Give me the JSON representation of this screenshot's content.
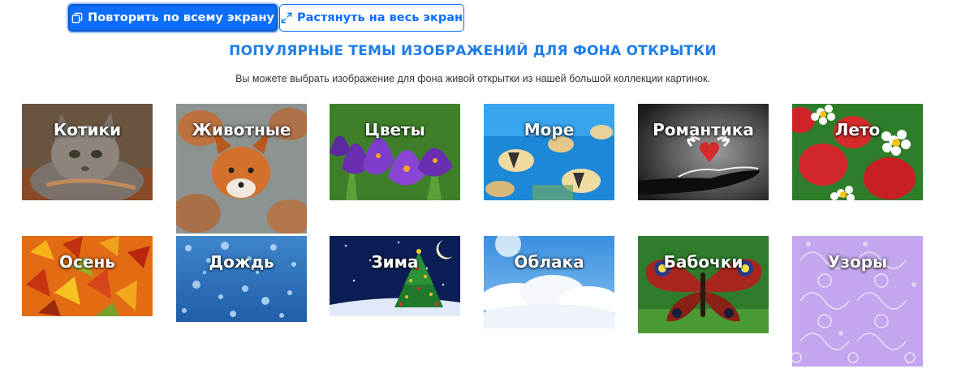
{
  "toolbar": {
    "repeat_label": "Повторить по всему экрану",
    "stretch_label": "Растянуть на весь экран"
  },
  "section": {
    "title": "ПОПУЛЯРНЫЕ ТЕМЫ ИЗОБРАЖЕНИЙ ДЛЯ ФОНА ОТКРЫТКИ",
    "subtitle": "Вы можете выбрать изображение для фона живой открытки из нашей большой коллекции картинок."
  },
  "categories": [
    {
      "label": "Котики",
      "theme": "cat"
    },
    {
      "label": "Животные",
      "theme": "fox"
    },
    {
      "label": "Цветы",
      "theme": "crocus"
    },
    {
      "label": "Море",
      "theme": "sea"
    },
    {
      "label": "Романтика",
      "theme": "romance"
    },
    {
      "label": "Лето",
      "theme": "strawberry"
    },
    {
      "label": "Осень",
      "theme": "leaves"
    },
    {
      "label": "Дождь",
      "theme": "rain"
    },
    {
      "label": "Зима",
      "theme": "winter"
    },
    {
      "label": "Облака",
      "theme": "clouds"
    },
    {
      "label": "Бабочки",
      "theme": "butterfly"
    },
    {
      "label": "Узоры",
      "theme": "pattern"
    }
  ],
  "colors": {
    "primary": "#0d6efd",
    "title": "#1f7fe8"
  }
}
